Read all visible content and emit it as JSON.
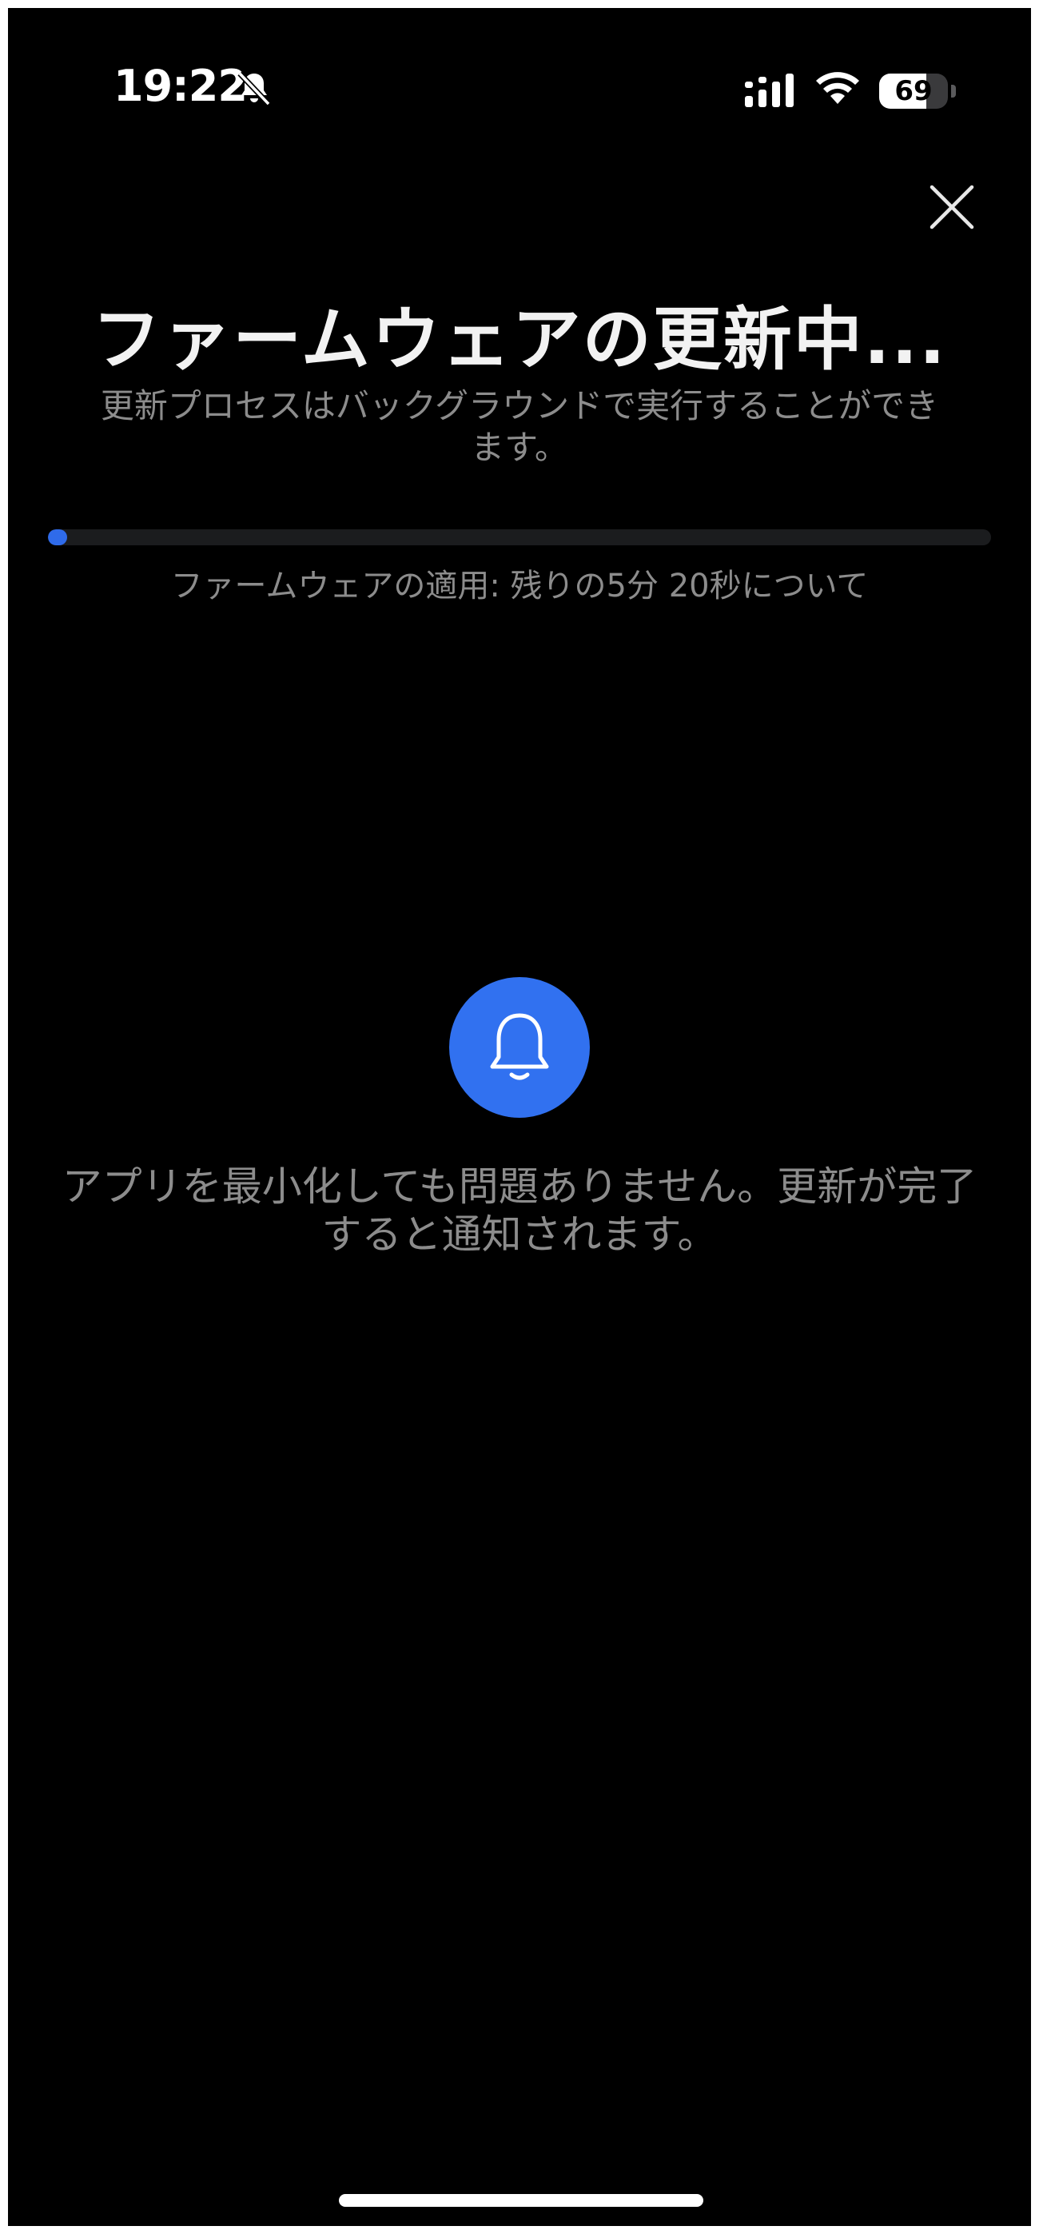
{
  "status_bar": {
    "time": "19:22",
    "battery_level": 69,
    "battery_label": "69",
    "icons": [
      "bell-slash-icon",
      "cellular-signal-icon",
      "wifi-icon",
      "battery-icon"
    ]
  },
  "header": {
    "close_icon": "close-icon",
    "title": "ファームウェアの更新中...",
    "subtitle": "更新プロセスはバックグラウンドで実行することができます。"
  },
  "progress": {
    "fraction": 0.02,
    "label": "ファームウェアの適用: 残りの5分 20秒について",
    "color": "#2f6bea"
  },
  "notice": {
    "icon": "bell-icon",
    "icon_bg": "#3171f0",
    "text": "アプリを最小化しても問題ありません。更新が完了すると通知されます。"
  }
}
